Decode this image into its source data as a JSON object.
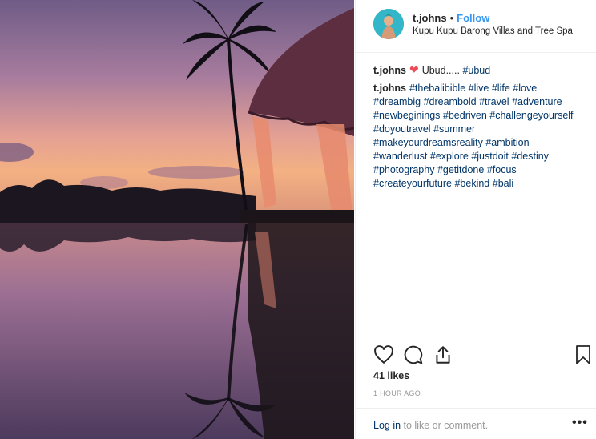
{
  "post": {
    "photo_description_icon": "sunset-reflection-photo",
    "author": {
      "username": "t.johns",
      "separator": "•",
      "follow_label": "Follow",
      "location": "Kupu Kupu Barong Villas and Tree Spa"
    },
    "caption": {
      "username": "t.johns",
      "text": "Ubud.....",
      "hashtag": "#ubud"
    },
    "comment": {
      "username": "t.johns",
      "lines": [
        [
          "#thebalibible",
          "#live",
          "#life",
          "#love"
        ],
        [
          "#dreambig",
          "#dreambold",
          "#travel",
          "#adventure"
        ],
        [
          "#newbeginings",
          "#bedriven",
          "#challengeyourself"
        ],
        [
          "#doyoutravel",
          "#summer"
        ],
        [
          "#makeyourdreamsreality",
          "#ambition"
        ],
        [
          "#wanderlust",
          "#explore",
          "#justdoit",
          "#destiny"
        ],
        [
          "#photography",
          "#getitdone",
          "#focus"
        ],
        [
          "#createyourfuture",
          "#bekind",
          "#bali"
        ]
      ]
    },
    "likes": "41 likes",
    "timestamp": "1 HOUR AGO",
    "footer": {
      "login_link": "Log in",
      "login_rest": " to like or comment.",
      "more_label": "•••"
    }
  },
  "colors": {
    "link": "#3897f0",
    "hashtag": "#003569",
    "heart": "#ed4956",
    "muted": "#999999"
  }
}
